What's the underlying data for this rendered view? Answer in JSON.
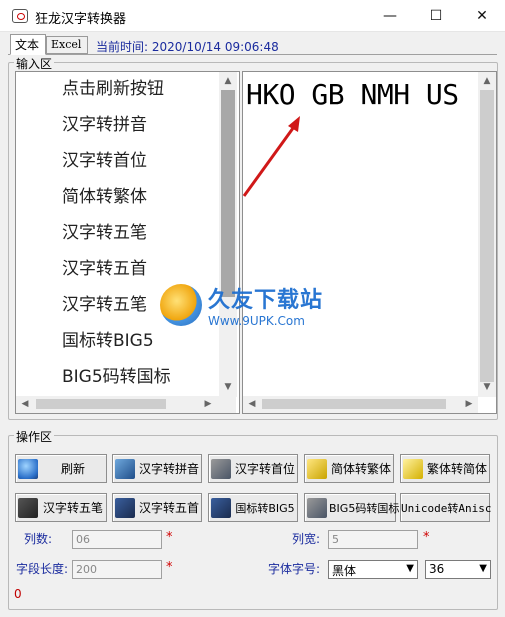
{
  "window": {
    "title": "狂龙汉字转换器",
    "minimize_glyph": "—",
    "maximize_glyph": "☐",
    "close_glyph": "✕"
  },
  "tabs": [
    {
      "label": "文本",
      "active": true
    },
    {
      "label": "Excel",
      "active": false
    }
  ],
  "time_display": "当前时间: 2020/10/14   09:06:48",
  "input_area": {
    "title": "输入区",
    "list_items": [
      "点击刷新按钮",
      "汉字转拼音",
      "汉字转首位",
      "简体转繁体",
      "汉字转五笔",
      "汉字转五首",
      "汉字转五笔",
      "国标转BIG5",
      "BIG5码转国标"
    ],
    "output_text": "HKO GB NMH US"
  },
  "watermark": {
    "title": "久友下载站",
    "url": "Www.9UPK.Com"
  },
  "operation_area": {
    "title": "操作区",
    "buttons_row1": [
      {
        "label": "刷新",
        "icon": "globe-icon"
      },
      {
        "label": "汉字转拼音",
        "icon": "document-icon"
      },
      {
        "label": "汉字转首位",
        "icon": "document-icon"
      },
      {
        "label": "简体转繁体",
        "icon": "book-icon"
      },
      {
        "label": "繁体转简体",
        "icon": "book-icon"
      }
    ],
    "buttons_row2": [
      {
        "label": "汉字转五笔",
        "icon": "keyboard-icon"
      },
      {
        "label": "汉字转五首",
        "icon": "document-icon"
      },
      {
        "label": "国标转BIG5",
        "icon": "document-icon"
      },
      {
        "label": "BIG5码转国标",
        "icon": "gear-icon"
      },
      {
        "label": "Unicode转Anisc",
        "icon": ""
      }
    ],
    "fields": {
      "columns_label": "列数:",
      "columns_value": "06",
      "width_label": "列宽:",
      "width_value": "5",
      "field_length_label": "字段长度:",
      "field_length_value": "200",
      "font_label": "字体字号:",
      "font_value": "黑体",
      "font_size_value": "36",
      "required_mark": "*"
    },
    "status_value": "0"
  },
  "colors": {
    "accent_text": "#1a2b9e",
    "required": "#d00000",
    "background": "#f0f0f0"
  }
}
